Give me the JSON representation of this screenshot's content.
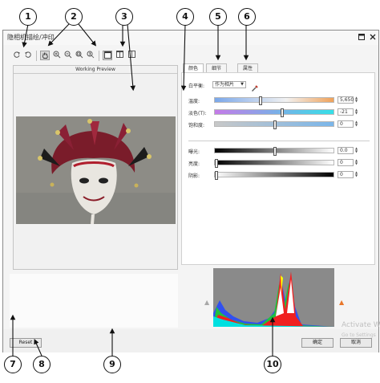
{
  "window": {
    "title": "隐相机描绘/冲印",
    "maximize_icon": "maximize-icon",
    "close_icon": "close-icon"
  },
  "toolbar": {
    "items": [
      "rotate-left-icon",
      "rotate-right-icon",
      "pan-hand-icon",
      "zoom-in-icon",
      "zoom-out-icon",
      "zoom-fit-icon",
      "zoom-actual-icon",
      "single-view-icon",
      "split-view-icon",
      "side-by-side-icon"
    ]
  },
  "preview": {
    "title": "Working Preview"
  },
  "tabs": [
    "颜色",
    "细节",
    "属性"
  ],
  "color_panel": {
    "white_balance": {
      "label": "白平衡:",
      "value": "作为相片",
      "icon": "eyedropper-icon"
    },
    "sliders_top": [
      {
        "label": "温度:",
        "value": "5,650",
        "position": 0.38
      },
      {
        "label": "淡色(T):",
        "value": "-21",
        "position": 0.56
      },
      {
        "label": "饱和度:",
        "value": "0",
        "position": 0.5
      }
    ],
    "sliders_bottom": [
      {
        "label": "曝光:",
        "value": "0.0",
        "position": 0.5
      },
      {
        "label": "亮度:",
        "value": "0",
        "position": 0.0
      },
      {
        "label": "阴影:",
        "value": "0",
        "position": 0.0
      }
    ]
  },
  "histogram": {
    "warn_left_icon": "clipping-warning-shadows-icon",
    "warn_right_icon": "clipping-warning-highlights-icon",
    "warn_glyph": "▲"
  },
  "buttons": {
    "reset": "Reset",
    "ok": "确定",
    "cancel": "取消"
  },
  "watermark": {
    "line1": "Activate W",
    "line2": "Go to Settings"
  },
  "callouts": [
    "1",
    "2",
    "3",
    "4",
    "5",
    "6",
    "7",
    "8",
    "9",
    "10"
  ],
  "colors": {
    "accent_warn": "#e8762a",
    "warn_gray": "#a8a8a8"
  }
}
